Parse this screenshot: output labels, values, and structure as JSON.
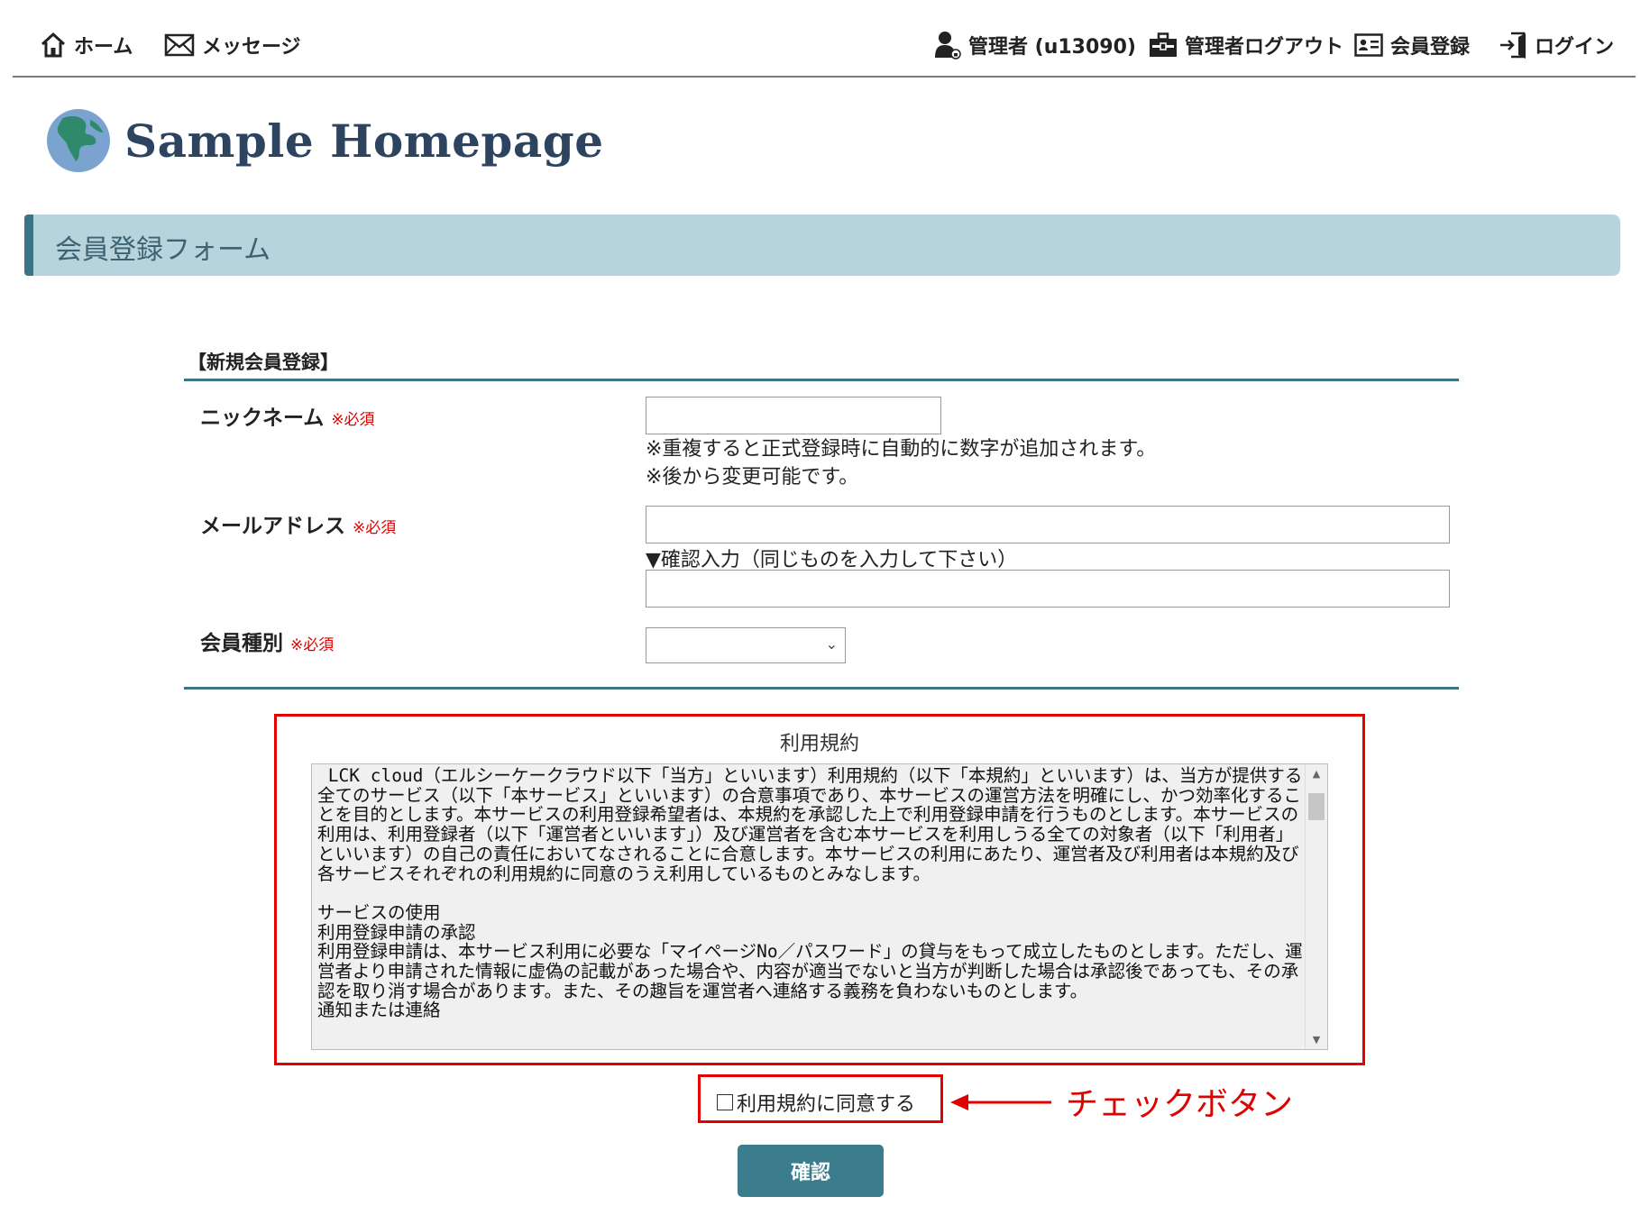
{
  "nav": {
    "home": "ホーム",
    "messages": "メッセージ",
    "admin_user": "管理者 (u13090)",
    "admin_logout": "管理者ログアウト",
    "register": "会員登録",
    "login": "ログイン"
  },
  "logo": {
    "text": "Sample Homepage"
  },
  "page_title": "会員登録フォーム",
  "form": {
    "section_title": "【新規会員登録】",
    "required_mark": "※必須",
    "nickname": {
      "label": "ニックネーム",
      "value": "",
      "note1": "※重複すると正式登録時に自動的に数字が追加されます。",
      "note2": "※後から変更可能です。"
    },
    "email": {
      "label": "メールアドレス",
      "value": "",
      "confirm_label": "▼確認入力（同じものを入力して下さい）",
      "confirm_value": ""
    },
    "member_type": {
      "label": "会員種別",
      "selected": ""
    }
  },
  "terms": {
    "title": "利用規約",
    "text": " LCK cloud（エルシーケークラウド以下「当方」といいます）利用規約（以下「本規約」といいます）は、当方が提供する全てのサービス（以下「本サービス」といいます）の合意事項であり、本サービスの運営方法を明確にし、かつ効率化することを目的とします。本サービスの利用登録希望者は、本規約を承認した上で利用登録申請を行うものとします。本サービスの利用は、利用登録者（以下「運営者といいます」）及び運営者を含む本サービスを利用しうる全ての対象者（以下「利用者」といいます）の自己の責任においてなされることに合意します。本サービスの利用にあたり、運営者及び利用者は本規約及び各サービスそれぞれの利用規約に同意のうえ利用しているものとみなします。\n\nサービスの使用\n利用登録申請の承認\n利用登録申請は、本サービス利用に必要な「マイページNo／パスワード」の貸与をもって成立したものとします。ただし、運営者より申請された情報に虚偽の記載があった場合や、内容が適当でないと当方が判断した場合は承認後であっても、その承認を取り消す場合があります。また、その趣旨を運営者へ連絡する義務を負わないものとします。\n通知または連絡"
  },
  "agree": {
    "label": "利用規約に同意する",
    "checked": false
  },
  "annotation": {
    "text": "チェックボタン"
  },
  "confirm_button": "確認"
}
